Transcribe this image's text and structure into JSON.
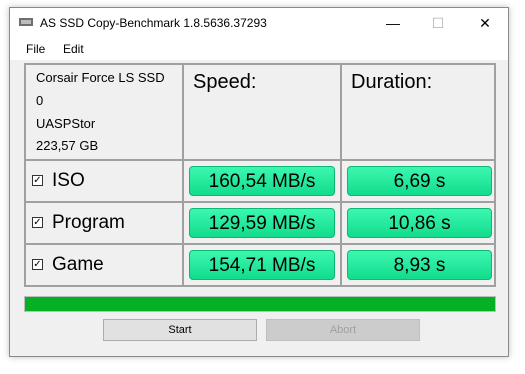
{
  "window": {
    "title": "AS SSD Copy-Benchmark 1.8.5636.37293",
    "minimize": "—",
    "maximize": "☐",
    "close": "✕"
  },
  "menu": {
    "file": "File",
    "edit": "Edit"
  },
  "drive": {
    "model": "Corsair Force LS SSD",
    "index": "0",
    "driver": "UASPStor",
    "size": "223,57 GB"
  },
  "headers": {
    "speed": "Speed:",
    "duration": "Duration:"
  },
  "rows": [
    {
      "label": "ISO",
      "checked": true,
      "speed": "160,54 MB/s",
      "duration": "6,69 s"
    },
    {
      "label": "Program",
      "checked": true,
      "speed": "129,59 MB/s",
      "duration": "10,86 s"
    },
    {
      "label": "Game",
      "checked": true,
      "speed": "154,71 MB/s",
      "duration": "8,93 s"
    }
  ],
  "progress": {
    "percent": 100
  },
  "buttons": {
    "start": "Start",
    "abort": "Abort"
  },
  "colors": {
    "result_bg": "#1fe89d",
    "progress_fill": "#06b025"
  }
}
